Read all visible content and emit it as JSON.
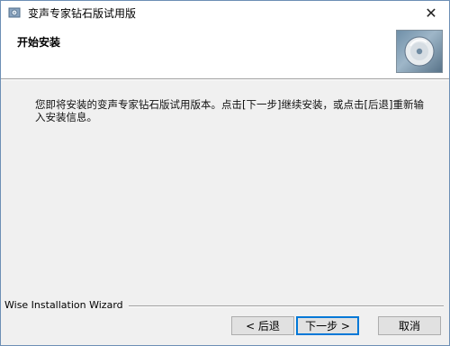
{
  "window": {
    "title": "变声专家钻石版试用版",
    "close_glyph": "✕"
  },
  "header": {
    "title": "开始安装",
    "icon": "cd-disc-icon"
  },
  "body": {
    "message": "您即将安装的变声专家钻石版试用版本。点击[下一步]继续安装，或点击[后退]重新输入安装信息。"
  },
  "footer": {
    "wizard_label": "Wise Installation Wizard"
  },
  "buttons": {
    "back": "< 后退",
    "next": "下一步 >",
    "cancel": "取消"
  },
  "colors": {
    "window_border": "#6d8fb5",
    "default_button_border": "#0078d7"
  }
}
